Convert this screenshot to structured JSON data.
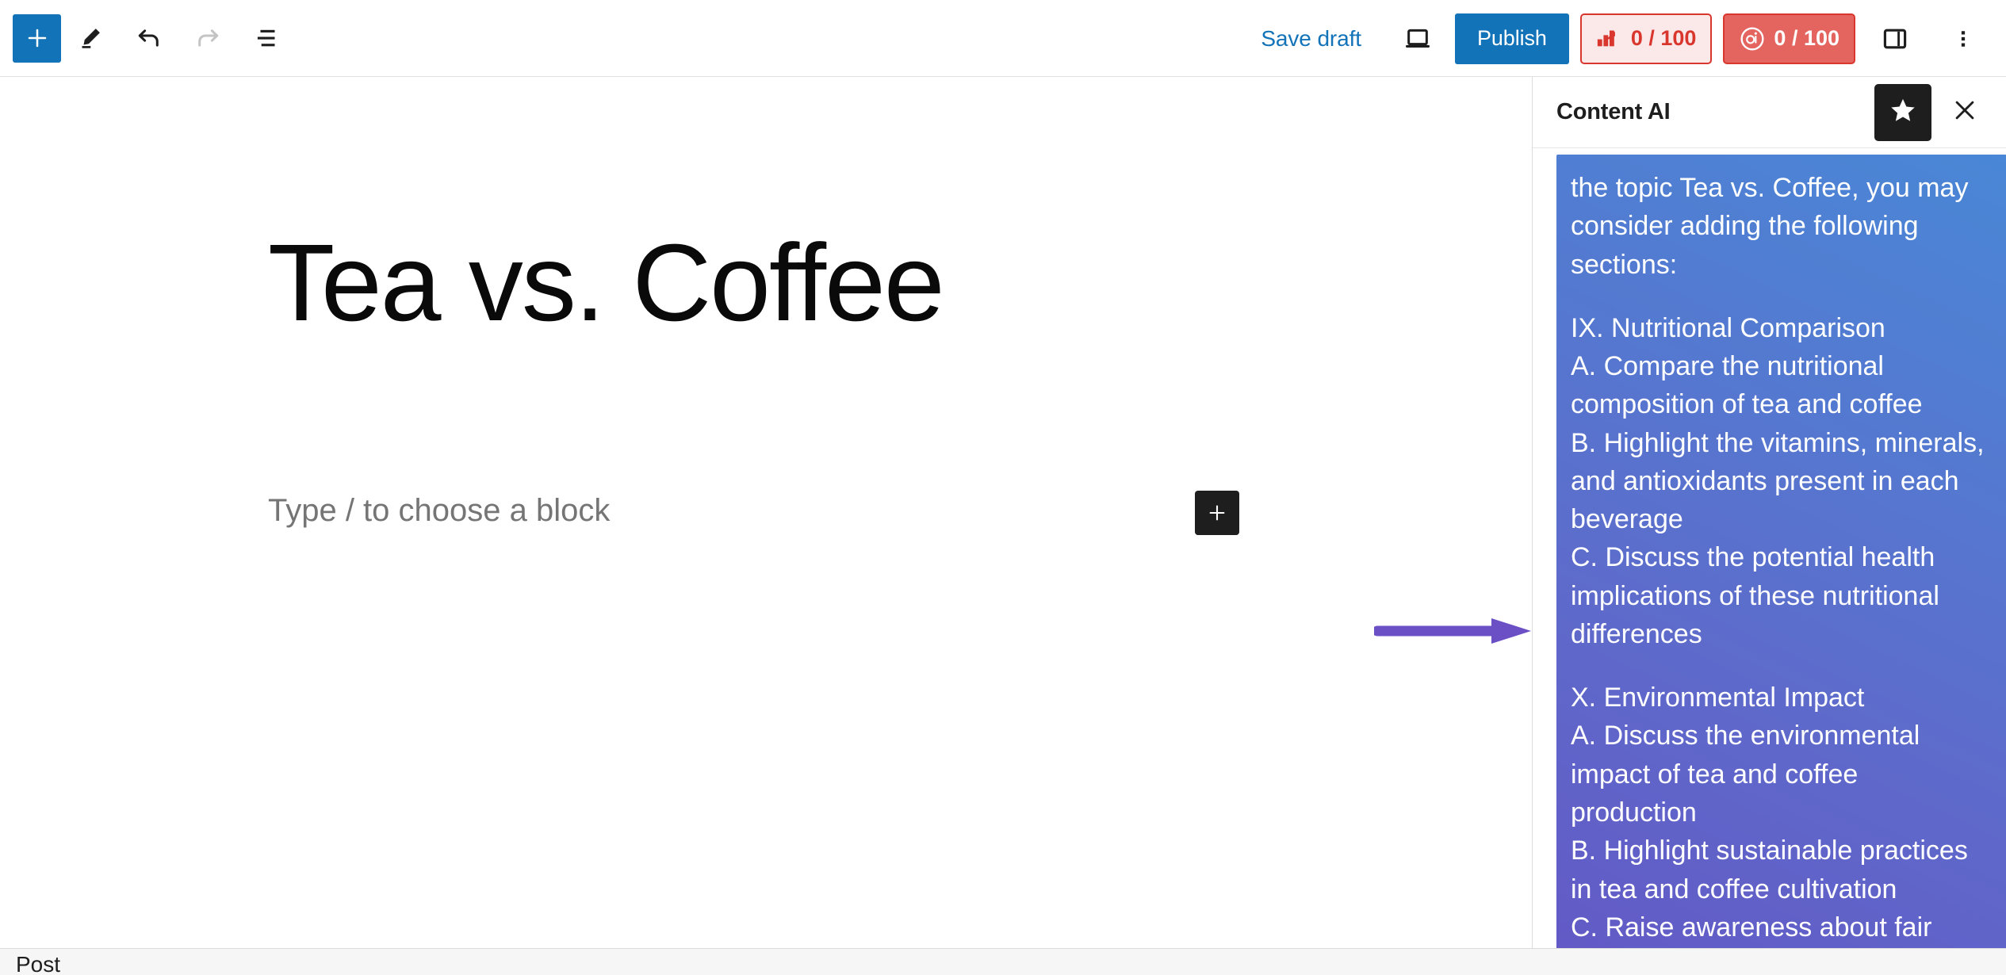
{
  "toolbar": {
    "add_block_label": "+",
    "add_block_icon": "plus-icon",
    "edit_icon": "pencil-icon",
    "undo_icon": "undo-arrow-icon",
    "redo_icon": "redo-arrow-icon",
    "outline_icon": "document-outline-icon"
  },
  "header": {
    "save_draft_label": "Save draft",
    "preview_icon": "laptop-preview-icon",
    "publish_label": "Publish",
    "seo_score": {
      "icon": "seo-chart-icon",
      "value": "0 / 100",
      "bg": "#fbe9e9",
      "border": "#d9362e",
      "color": "#d9362e"
    },
    "content_ai_score": {
      "icon": "content-ai-logo-icon",
      "value": "0 / 100",
      "bg": "#e4655f",
      "border": "#d9362e",
      "color": "#ffffff"
    },
    "settings_sidebar_icon": "sidebar-toggle-icon",
    "more_options_icon": "kebab-menu-icon"
  },
  "editor": {
    "post_title": "Tea vs. Coffee",
    "block_placeholder": "Type / to choose a block",
    "inline_add_icon": "plus-icon"
  },
  "annotation": {
    "arrow_icon": "arrow-right-annotation",
    "color": "#6b4fc4"
  },
  "sidebar": {
    "title": "Content AI",
    "star_icon": "star-icon",
    "close_icon": "close-x-icon",
    "message_paragraphs": [
      "the topic Tea vs. Coffee, you may consider adding the following sections:",
      "IX. Nutritional Comparison\nA. Compare the nutritional composition of tea and coffee\nB. Highlight the vitamins, minerals, and antioxidants present in each beverage\nC. Discuss the potential health implications of these nutritional differences",
      "X. Environmental Impact\nA. Discuss the environmental impact of tea and coffee production\nB. Highlight sustainable practices in tea and coffee cultivation\nC. Raise awareness about fair"
    ],
    "gradient_start": "#4a87d6",
    "gradient_end": "#6359c6"
  },
  "bottom_bar": {
    "label": "Post"
  },
  "colors": {
    "accent_blue": "#1273b8",
    "dark": "#1e1e1e",
    "danger_red": "#d9362e"
  }
}
